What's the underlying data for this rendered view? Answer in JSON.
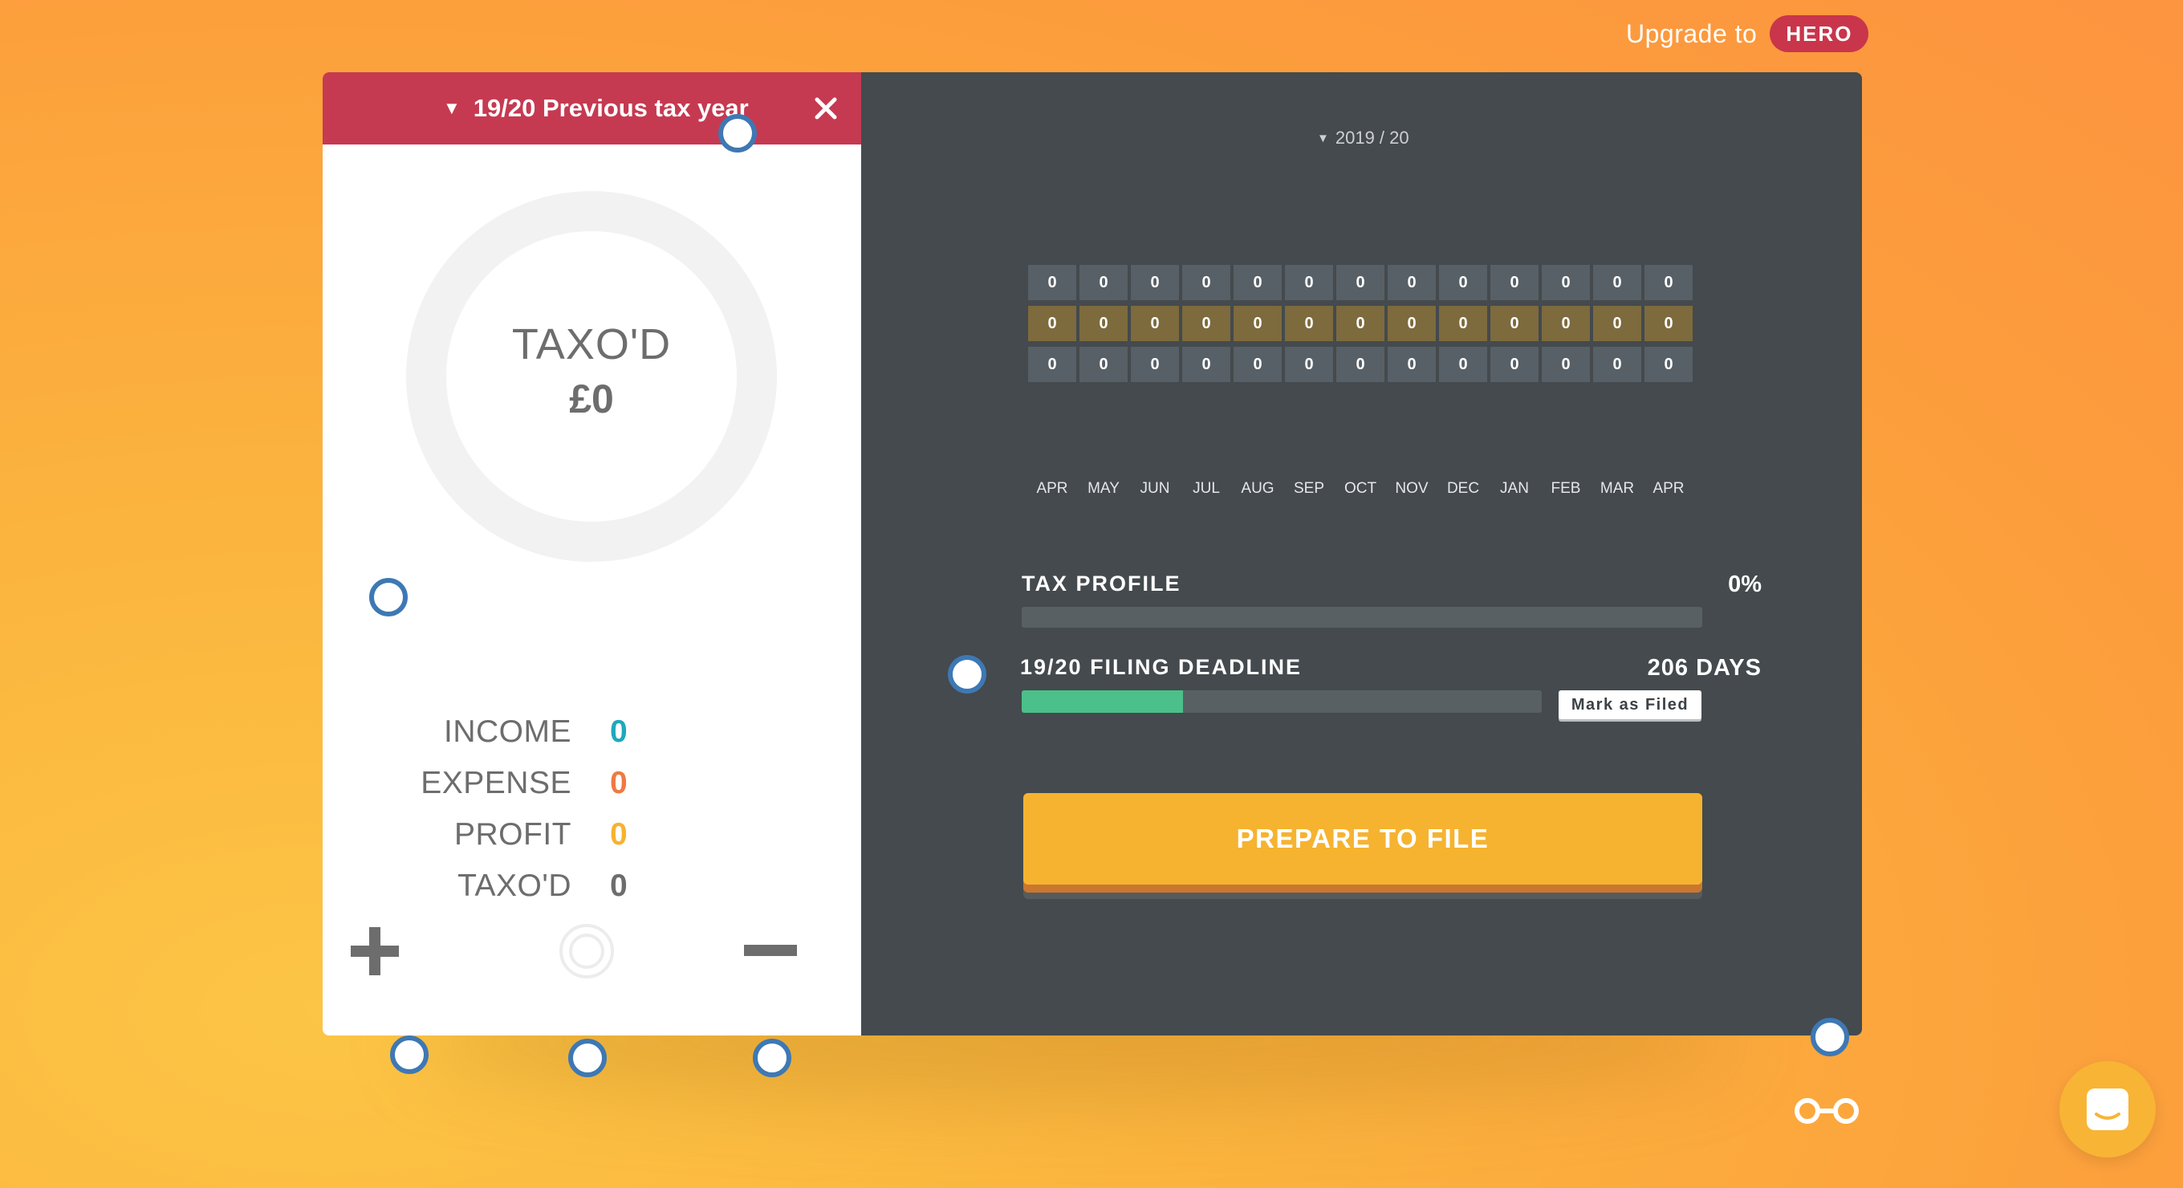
{
  "upgrade": {
    "text": "Upgrade to",
    "badge": "HERO"
  },
  "left_panel": {
    "year_selector": {
      "caret": "▼",
      "label": "19/20 Previous tax year"
    },
    "close_icon": "close-icon",
    "donut": {
      "title": "TAXO'D",
      "value": "£0"
    },
    "stats": [
      {
        "label": "INCOME",
        "value": "0",
        "color": "#1fa8bd"
      },
      {
        "label": "EXPENSE",
        "value": "0",
        "color": "#f07943"
      },
      {
        "label": "PROFIT",
        "value": "0",
        "color": "#f6b330"
      },
      {
        "label": "TAXO'D",
        "value": "0",
        "color": "#6d6d6d"
      }
    ],
    "actions": [
      {
        "name": "add-button",
        "icon": "plus-icon"
      },
      {
        "name": "target-button",
        "icon": "target-icon"
      },
      {
        "name": "subtract-button",
        "icon": "minus-icon"
      }
    ]
  },
  "right_panel": {
    "tax_year": {
      "caret": "▼",
      "label": "2019 / 20"
    },
    "months": [
      {
        "label": "APR",
        "values": [
          "0",
          "0",
          "0"
        ]
      },
      {
        "label": "MAY",
        "values": [
          "0",
          "0",
          "0"
        ]
      },
      {
        "label": "JUN",
        "values": [
          "0",
          "0",
          "0"
        ]
      },
      {
        "label": "JUL",
        "values": [
          "0",
          "0",
          "0"
        ]
      },
      {
        "label": "AUG",
        "values": [
          "0",
          "0",
          "0"
        ]
      },
      {
        "label": "SEP",
        "values": [
          "0",
          "0",
          "0"
        ]
      },
      {
        "label": "OCT",
        "values": [
          "0",
          "0",
          "0"
        ]
      },
      {
        "label": "NOV",
        "values": [
          "0",
          "0",
          "0"
        ]
      },
      {
        "label": "DEC",
        "values": [
          "0",
          "0",
          "0"
        ]
      },
      {
        "label": "JAN",
        "values": [
          "0",
          "0",
          "0"
        ]
      },
      {
        "label": "FEB",
        "values": [
          "0",
          "0",
          "0"
        ]
      },
      {
        "label": "MAR",
        "values": [
          "0",
          "0",
          "0"
        ]
      },
      {
        "label": "APR",
        "values": [
          "0",
          "0",
          "0"
        ]
      }
    ],
    "tax_profile": {
      "label": "TAX PROFILE",
      "percent_text": "0%",
      "progress": 0
    },
    "filing_deadline": {
      "label": "19/20 FILING DEADLINE",
      "days_text": "206 DAYS",
      "progress": 0.31,
      "mark_button": "Mark as Filed"
    },
    "pager": {
      "count": 5,
      "active_index": 3
    },
    "prepare_button": "PREPARE TO FILE"
  },
  "colors": {
    "header_red": "#c53a51",
    "dark_panel": "#444a4d",
    "accent_yellow": "#f6b330",
    "green": "#4cc08a",
    "hotspot_blue": "#3e78b4"
  },
  "icons": {
    "glasses": "glasses-icon",
    "chat": "chat-icon"
  }
}
